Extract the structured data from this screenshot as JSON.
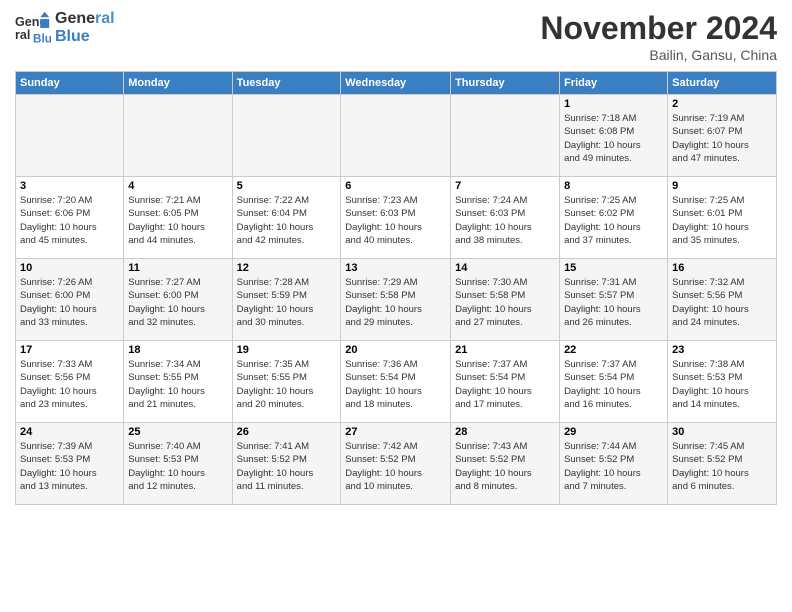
{
  "header": {
    "logo_line1": "General",
    "logo_line2": "Blue",
    "month": "November 2024",
    "location": "Bailin, Gansu, China"
  },
  "weekdays": [
    "Sunday",
    "Monday",
    "Tuesday",
    "Wednesday",
    "Thursday",
    "Friday",
    "Saturday"
  ],
  "weeks": [
    [
      {
        "day": "",
        "info": ""
      },
      {
        "day": "",
        "info": ""
      },
      {
        "day": "",
        "info": ""
      },
      {
        "day": "",
        "info": ""
      },
      {
        "day": "",
        "info": ""
      },
      {
        "day": "1",
        "info": "Sunrise: 7:18 AM\nSunset: 6:08 PM\nDaylight: 10 hours\nand 49 minutes."
      },
      {
        "day": "2",
        "info": "Sunrise: 7:19 AM\nSunset: 6:07 PM\nDaylight: 10 hours\nand 47 minutes."
      }
    ],
    [
      {
        "day": "3",
        "info": "Sunrise: 7:20 AM\nSunset: 6:06 PM\nDaylight: 10 hours\nand 45 minutes."
      },
      {
        "day": "4",
        "info": "Sunrise: 7:21 AM\nSunset: 6:05 PM\nDaylight: 10 hours\nand 44 minutes."
      },
      {
        "day": "5",
        "info": "Sunrise: 7:22 AM\nSunset: 6:04 PM\nDaylight: 10 hours\nand 42 minutes."
      },
      {
        "day": "6",
        "info": "Sunrise: 7:23 AM\nSunset: 6:03 PM\nDaylight: 10 hours\nand 40 minutes."
      },
      {
        "day": "7",
        "info": "Sunrise: 7:24 AM\nSunset: 6:03 PM\nDaylight: 10 hours\nand 38 minutes."
      },
      {
        "day": "8",
        "info": "Sunrise: 7:25 AM\nSunset: 6:02 PM\nDaylight: 10 hours\nand 37 minutes."
      },
      {
        "day": "9",
        "info": "Sunrise: 7:25 AM\nSunset: 6:01 PM\nDaylight: 10 hours\nand 35 minutes."
      }
    ],
    [
      {
        "day": "10",
        "info": "Sunrise: 7:26 AM\nSunset: 6:00 PM\nDaylight: 10 hours\nand 33 minutes."
      },
      {
        "day": "11",
        "info": "Sunrise: 7:27 AM\nSunset: 6:00 PM\nDaylight: 10 hours\nand 32 minutes."
      },
      {
        "day": "12",
        "info": "Sunrise: 7:28 AM\nSunset: 5:59 PM\nDaylight: 10 hours\nand 30 minutes."
      },
      {
        "day": "13",
        "info": "Sunrise: 7:29 AM\nSunset: 5:58 PM\nDaylight: 10 hours\nand 29 minutes."
      },
      {
        "day": "14",
        "info": "Sunrise: 7:30 AM\nSunset: 5:58 PM\nDaylight: 10 hours\nand 27 minutes."
      },
      {
        "day": "15",
        "info": "Sunrise: 7:31 AM\nSunset: 5:57 PM\nDaylight: 10 hours\nand 26 minutes."
      },
      {
        "day": "16",
        "info": "Sunrise: 7:32 AM\nSunset: 5:56 PM\nDaylight: 10 hours\nand 24 minutes."
      }
    ],
    [
      {
        "day": "17",
        "info": "Sunrise: 7:33 AM\nSunset: 5:56 PM\nDaylight: 10 hours\nand 23 minutes."
      },
      {
        "day": "18",
        "info": "Sunrise: 7:34 AM\nSunset: 5:55 PM\nDaylight: 10 hours\nand 21 minutes."
      },
      {
        "day": "19",
        "info": "Sunrise: 7:35 AM\nSunset: 5:55 PM\nDaylight: 10 hours\nand 20 minutes."
      },
      {
        "day": "20",
        "info": "Sunrise: 7:36 AM\nSunset: 5:54 PM\nDaylight: 10 hours\nand 18 minutes."
      },
      {
        "day": "21",
        "info": "Sunrise: 7:37 AM\nSunset: 5:54 PM\nDaylight: 10 hours\nand 17 minutes."
      },
      {
        "day": "22",
        "info": "Sunrise: 7:37 AM\nSunset: 5:54 PM\nDaylight: 10 hours\nand 16 minutes."
      },
      {
        "day": "23",
        "info": "Sunrise: 7:38 AM\nSunset: 5:53 PM\nDaylight: 10 hours\nand 14 minutes."
      }
    ],
    [
      {
        "day": "24",
        "info": "Sunrise: 7:39 AM\nSunset: 5:53 PM\nDaylight: 10 hours\nand 13 minutes."
      },
      {
        "day": "25",
        "info": "Sunrise: 7:40 AM\nSunset: 5:53 PM\nDaylight: 10 hours\nand 12 minutes."
      },
      {
        "day": "26",
        "info": "Sunrise: 7:41 AM\nSunset: 5:52 PM\nDaylight: 10 hours\nand 11 minutes."
      },
      {
        "day": "27",
        "info": "Sunrise: 7:42 AM\nSunset: 5:52 PM\nDaylight: 10 hours\nand 10 minutes."
      },
      {
        "day": "28",
        "info": "Sunrise: 7:43 AM\nSunset: 5:52 PM\nDaylight: 10 hours\nand 8 minutes."
      },
      {
        "day": "29",
        "info": "Sunrise: 7:44 AM\nSunset: 5:52 PM\nDaylight: 10 hours\nand 7 minutes."
      },
      {
        "day": "30",
        "info": "Sunrise: 7:45 AM\nSunset: 5:52 PM\nDaylight: 10 hours\nand 6 minutes."
      }
    ]
  ]
}
